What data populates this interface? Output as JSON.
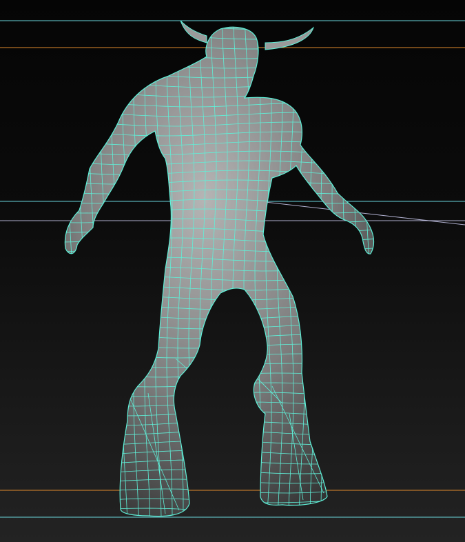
{
  "viewport": {
    "view": "perspective",
    "shading": "smooth-shaded-with-wireframe",
    "wireframe_color": "#5ff0d8",
    "surface_color": "#9a9a9a",
    "background_top": "#050505",
    "background_bottom": "#222222",
    "guide_line_cyan": "#6ad6dc",
    "guide_line_orange": "#e08a2c",
    "horizon_line_color": "#d8d8ff"
  },
  "model": {
    "icon": "character-model-icon",
    "subject": "minotaur",
    "selected": true
  }
}
